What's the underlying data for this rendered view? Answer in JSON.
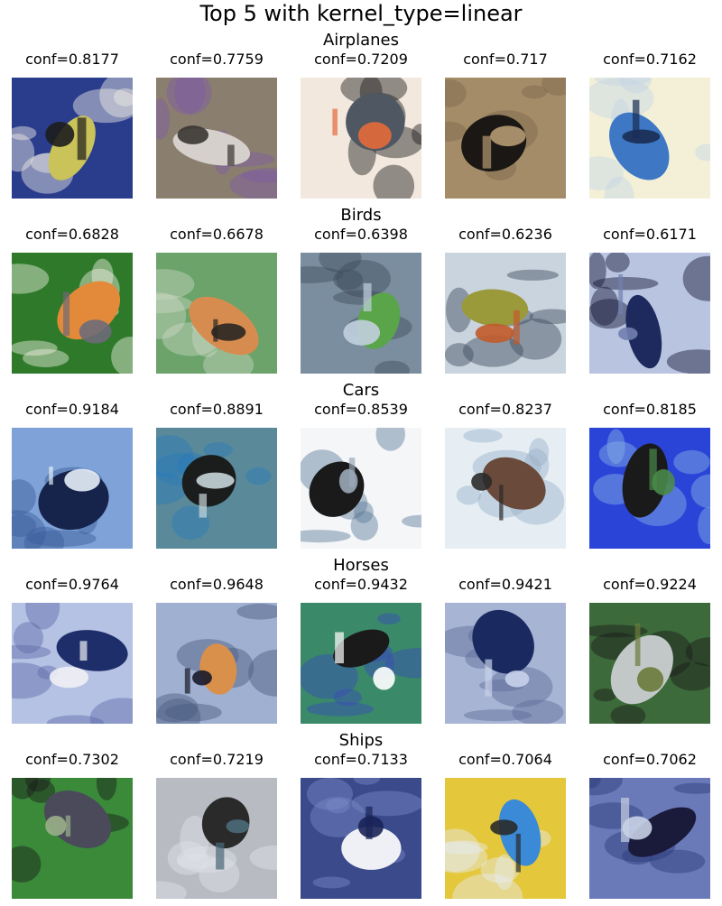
{
  "figure": {
    "title": "Top 5 with kernel_type=linear"
  },
  "sections": [
    {
      "name": "Airplanes",
      "items": [
        {
          "conf": "conf=0.8177",
          "image": "blimp-upside-down",
          "colors": [
            "#2a3c8c",
            "#c9c35a",
            "#1d1d1d",
            "#f2f0e6"
          ]
        },
        {
          "conf": "conf=0.7759",
          "image": "building-upside-down",
          "colors": [
            "#8a7e6f",
            "#d5d0cc",
            "#3a3532",
            "#7d5aa6"
          ]
        },
        {
          "conf": "conf=0.7209",
          "image": "fighter-plane",
          "colors": [
            "#f2e8de",
            "#4f5862",
            "#e36b3a",
            "#1a1a1a"
          ]
        },
        {
          "conf": "conf=0.717",
          "image": "airliner-silhouette",
          "colors": [
            "#a48c68",
            "#1a1714",
            "#b69a72",
            "#7a664c"
          ]
        },
        {
          "conf": "conf=0.7162",
          "image": "blue-bird-upside-down",
          "colors": [
            "#f4f0d8",
            "#3e78c4",
            "#1a2c54",
            "#c4d4e6"
          ]
        }
      ]
    },
    {
      "name": "Birds",
      "items": [
        {
          "conf": "conf=0.6828",
          "image": "robin-upside-down",
          "colors": [
            "#2f7a2a",
            "#e38a3a",
            "#6d6a78",
            "#f1efe5"
          ]
        },
        {
          "conf": "conf=0.6678",
          "image": "bird-hanging",
          "colors": [
            "#6ba36a",
            "#d78c4f",
            "#2a2622",
            "#c9d6c4"
          ]
        },
        {
          "conf": "conf=0.6398",
          "image": "green-parakeet",
          "colors": [
            "#7b8ea0",
            "#5aa44a",
            "#c2d0de",
            "#3e4c5a"
          ]
        },
        {
          "conf": "conf=0.6236",
          "image": "colorful-bird-upside-down",
          "colors": [
            "#c9d4de",
            "#9a9a3a",
            "#c25a2a",
            "#3b4a5a"
          ]
        },
        {
          "conf": "conf=0.6171",
          "image": "blue-birds-upside-down",
          "colors": [
            "#b8c4e0",
            "#1e2a5e",
            "#7080b0",
            "#0f1530"
          ]
        }
      ]
    },
    {
      "name": "Cars",
      "items": [
        {
          "conf": "conf=0.9184",
          "image": "horse-rider-upside-down",
          "colors": [
            "#7fa2d8",
            "#16244c",
            "#e6eef8",
            "#3a5a9a"
          ]
        },
        {
          "conf": "conf=0.8891",
          "image": "table-structure-upside-down",
          "colors": [
            "#5a8a9a",
            "#1b1c1c",
            "#c7d6da",
            "#2a7ab8"
          ]
        },
        {
          "conf": "conf=0.8539",
          "image": "car-upside-down",
          "colors": [
            "#f4f6f8",
            "#1a1a1a",
            "#9aa8b8",
            "#5a7a9a"
          ]
        },
        {
          "conf": "conf=0.8237",
          "image": "car-rotated",
          "colors": [
            "#e6eef4",
            "#6a4a3a",
            "#2a2a2a",
            "#9ab0c8"
          ]
        },
        {
          "conf": "conf=0.8185",
          "image": "blue-car-upside-down",
          "colors": [
            "#2a44d8",
            "#1a1a1a",
            "#4a8a4a",
            "#8ab4e4"
          ]
        }
      ]
    },
    {
      "name": "Horses",
      "items": [
        {
          "conf": "conf=0.9764",
          "image": "dark-horse-upside-down",
          "colors": [
            "#b6c2e4",
            "#1e2e6a",
            "#f0f0f4",
            "#5a6aa8"
          ]
        },
        {
          "conf": "conf=0.9648",
          "image": "bird-leaves",
          "colors": [
            "#a0b0d0",
            "#d8904a",
            "#1a1a2a",
            "#4a5a80"
          ]
        },
        {
          "conf": "conf=0.9432",
          "image": "striped-object",
          "colors": [
            "#3a8a6a",
            "#1a1a1a",
            "#ffffff",
            "#3a4ab8"
          ]
        },
        {
          "conf": "conf=0.9421",
          "image": "horses-upside-down",
          "colors": [
            "#a8b4d4",
            "#1a2a60",
            "#c8d2ea",
            "#5a6a9a"
          ]
        },
        {
          "conf": "conf=0.9224",
          "image": "hanging-bird",
          "colors": [
            "#3c6a3a",
            "#c2c8c8",
            "#6a7a3a",
            "#1a1a1a"
          ]
        }
      ]
    },
    {
      "name": "Ships",
      "items": [
        {
          "conf": "conf=0.7302",
          "image": "boar-animal",
          "colors": [
            "#3a8a3a",
            "#4a4a5a",
            "#9ab08a",
            "#1a1a1a"
          ]
        },
        {
          "conf": "conf=0.7219",
          "image": "metal-object-upside-down",
          "colors": [
            "#b8bcc2",
            "#2a2a2a",
            "#4a6a78",
            "#dfe3e8"
          ]
        },
        {
          "conf": "conf=0.7133",
          "image": "white-bird-upside-down",
          "colors": [
            "#3a4a8a",
            "#eef0f6",
            "#1a2458",
            "#7a8ac8"
          ]
        },
        {
          "conf": "conf=0.7064",
          "image": "toy-cars-upside-down",
          "colors": [
            "#e4c73a",
            "#3a8ad8",
            "#2a2a2a",
            "#e6eef6"
          ]
        },
        {
          "conf": "conf=0.7062",
          "image": "dark-animal-upside-down",
          "colors": [
            "#6a7ab8",
            "#1a1a3a",
            "#c8d0e4",
            "#2a3a7a"
          ]
        }
      ]
    }
  ]
}
